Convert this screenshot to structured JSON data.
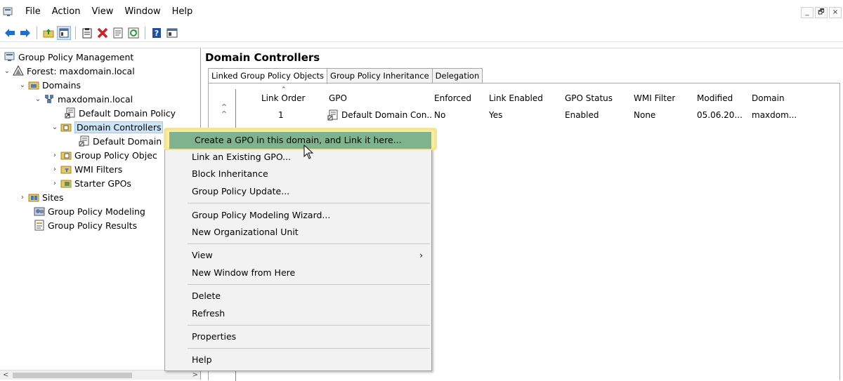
{
  "menubar": {
    "items": [
      "File",
      "Action",
      "View",
      "Window",
      "Help"
    ],
    "window_controls": [
      "_",
      "🗗",
      "×"
    ]
  },
  "toolbar": {
    "icons": [
      "back-arrow-icon",
      "forward-arrow-icon",
      "up-folder-icon",
      "show-hide-tree-icon",
      "clipboard-icon",
      "delete-icon",
      "properties-icon",
      "refresh-icon",
      "help-icon",
      "mmc-icon"
    ]
  },
  "tree": {
    "root": "Group Policy Management",
    "forest": "Forest: maxdomain.local",
    "domains": "Domains",
    "domain": "maxdomain.local",
    "default_domain_policy": "Default Domain Policy",
    "domain_controllers": "Domain Controllers",
    "default_domain_child": "Default Domain",
    "gpo_objects": "Group Policy Objec",
    "wmi_filters": "WMI Filters",
    "starter_gpos": "Starter GPOs",
    "sites": "Sites",
    "modeling": "Group Policy Modeling",
    "results": "Group Policy Results"
  },
  "right": {
    "title": "Domain Controllers",
    "tabs": [
      "Linked Group Policy Objects",
      "Group Policy Inheritance",
      "Delegation"
    ],
    "columns": [
      "Link Order",
      "GPO",
      "Enforced",
      "Link Enabled",
      "GPO Status",
      "WMI Filter",
      "Modified",
      "Domain"
    ],
    "rows": [
      {
        "link_order": "1",
        "gpo": "Default Domain Con...",
        "enforced": "No",
        "link_enabled": "Yes",
        "gpo_status": "Enabled",
        "wmi_filter": "None",
        "modified": "05.06.20...",
        "domain": "maxdom..."
      }
    ]
  },
  "context_menu": {
    "items": [
      "Create a GPO in this domain, and Link it here...",
      "Link an Existing GPO...",
      "Block Inheritance",
      "Group Policy Update...",
      "Group Policy Modeling Wizard...",
      "New Organizational Unit",
      "View",
      "New Window from Here",
      "Delete",
      "Refresh",
      "Properties",
      "Help"
    ],
    "highlight_color": "#7fb38f",
    "callout_color": "#f7e48e"
  }
}
